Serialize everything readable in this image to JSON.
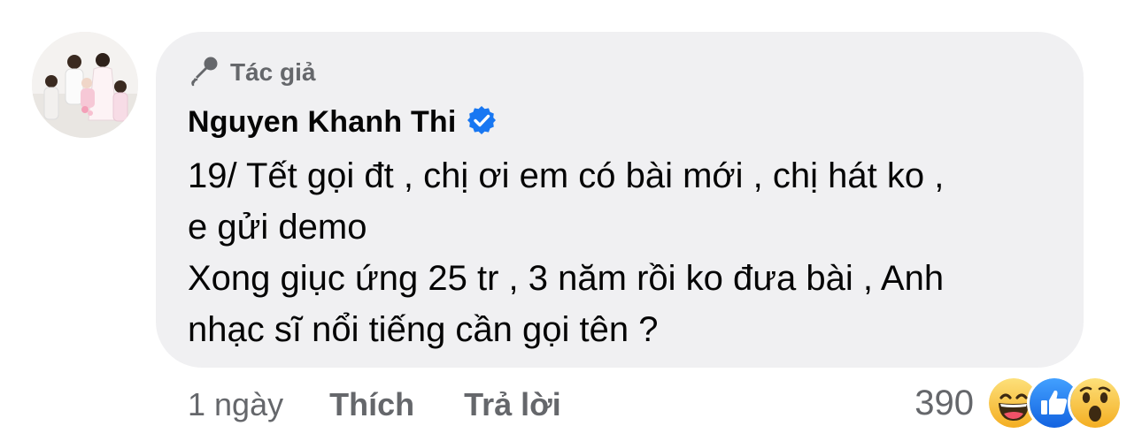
{
  "comment": {
    "badge_label": "Tác giả",
    "author_name": "Nguyen Khanh Thi",
    "verified": true,
    "text_lines": [
      "19/ Tết gọi đt , chị ơi em có bài mới , chị hát ko ,",
      "e gửi demo",
      "Xong giục ứng 25 tr , 3 năm rồi ko đưa bài , Anh",
      "nhạc sĩ nổi tiếng cần gọi tên ?"
    ]
  },
  "actions": {
    "time": "1 ngày",
    "like_label": "Thích",
    "reply_label": "Trả lời"
  },
  "reactions": {
    "count": "390",
    "types": [
      "haha-icon",
      "like-icon",
      "wow-icon"
    ]
  },
  "colors": {
    "bubble_bg": "#f0f0f2",
    "text_primary": "#050505",
    "text_secondary": "#65676b",
    "verified_blue": "#1877f2",
    "reaction_yellow": "#f7b125"
  }
}
